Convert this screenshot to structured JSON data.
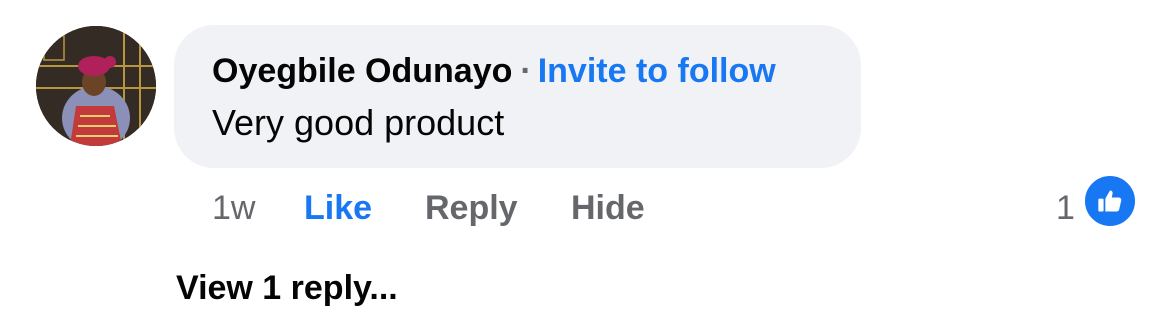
{
  "comment": {
    "author": "Oyegbile Odunayo",
    "separator": "·",
    "follow_action": "Invite to follow",
    "text": "Very good product",
    "avatar_icon": "user-avatar-photo"
  },
  "actions": {
    "time": "1w",
    "like": "Like",
    "reply": "Reply",
    "hide": "Hide"
  },
  "reactions": {
    "count": "1",
    "icon": "thumbs-up-icon",
    "color": "#1877f2"
  },
  "replies": {
    "view_label": "View 1 reply..."
  },
  "colors": {
    "accent": "#1877f2",
    "bubble": "#f0f2f5",
    "secondary_text": "#65676b",
    "primary_text": "#050505"
  }
}
